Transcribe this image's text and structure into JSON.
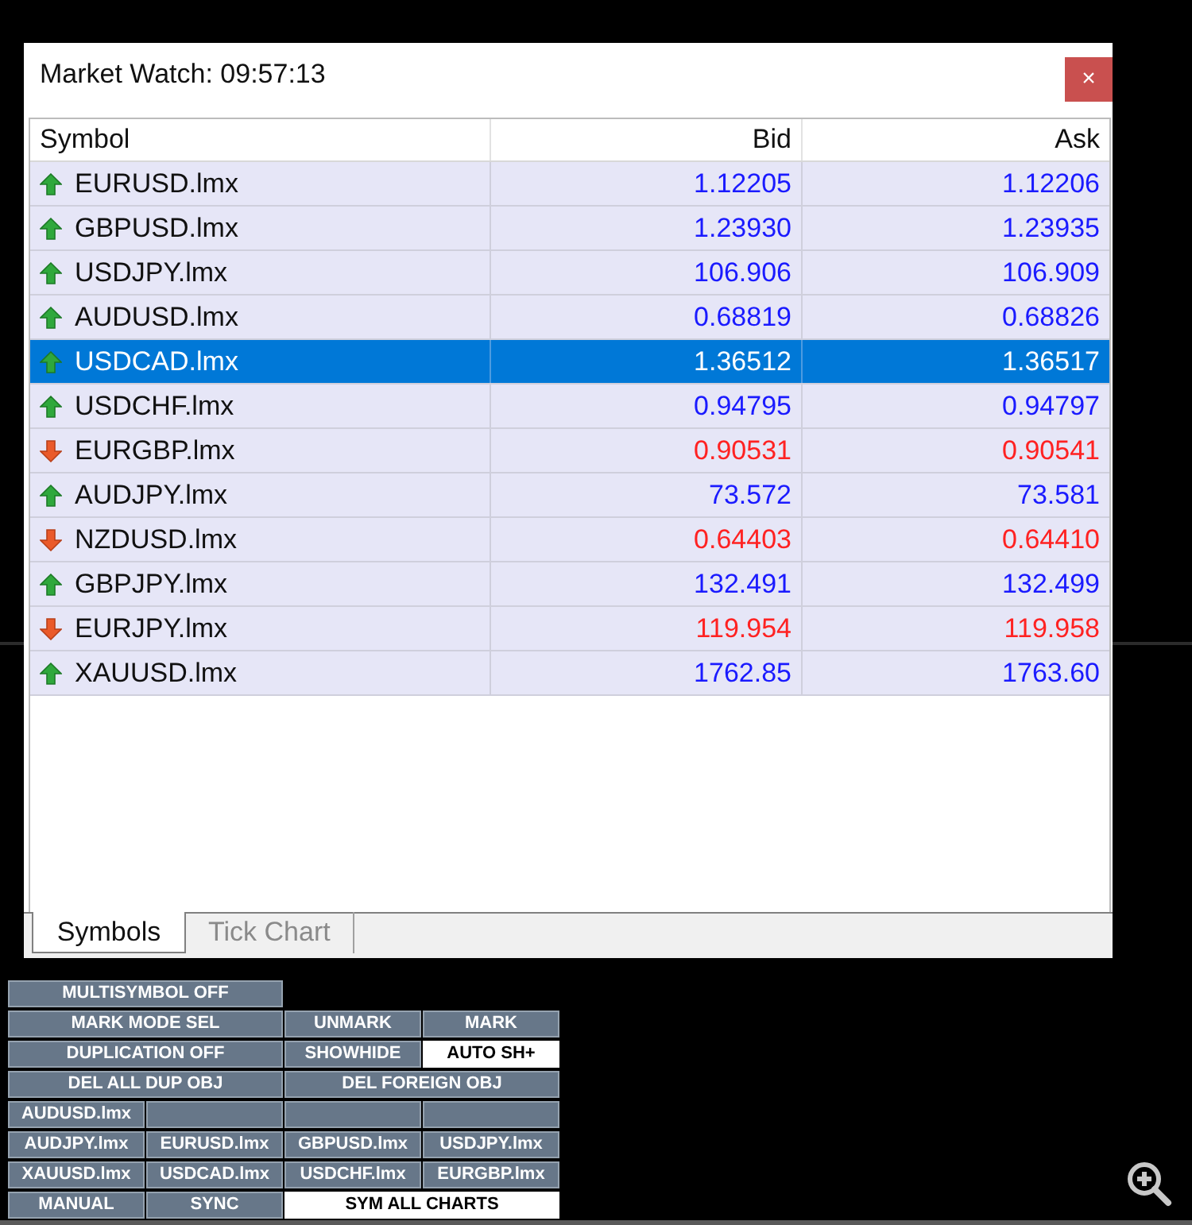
{
  "window": {
    "title": "Market Watch: 09:57:13",
    "close": "×"
  },
  "table": {
    "columns": [
      "Symbol",
      "Bid",
      "Ask"
    ],
    "rows": [
      {
        "symbol": "EURUSD.lmx",
        "bid": "1.12205",
        "ask": "1.12206",
        "kind": "up",
        "selected": false
      },
      {
        "symbol": "GBPUSD.lmx",
        "bid": "1.23930",
        "ask": "1.23935",
        "kind": "up",
        "selected": false
      },
      {
        "symbol": "USDJPY.lmx",
        "bid": "106.906",
        "ask": "106.909",
        "kind": "up",
        "selected": false
      },
      {
        "symbol": "AUDUSD.lmx",
        "bid": "0.68819",
        "ask": "0.68826",
        "kind": "up",
        "selected": false
      },
      {
        "symbol": "USDCAD.lmx",
        "bid": "1.36512",
        "ask": "1.36517",
        "kind": "up",
        "selected": true
      },
      {
        "symbol": "USDCHF.lmx",
        "bid": "0.94795",
        "ask": "0.94797",
        "kind": "up",
        "selected": false
      },
      {
        "symbol": "EURGBP.lmx",
        "bid": "0.90531",
        "ask": "0.90541",
        "kind": "down",
        "selected": false
      },
      {
        "symbol": "AUDJPY.lmx",
        "bid": "73.572",
        "ask": "73.581",
        "kind": "up",
        "selected": false
      },
      {
        "symbol": "NZDUSD.lmx",
        "bid": "0.64403",
        "ask": "0.64410",
        "kind": "down",
        "selected": false
      },
      {
        "symbol": "GBPJPY.lmx",
        "bid": "132.491",
        "ask": "132.499",
        "kind": "up",
        "selected": false
      },
      {
        "symbol": "EURJPY.lmx",
        "bid": "119.954",
        "ask": "119.958",
        "kind": "down",
        "selected": false
      },
      {
        "symbol": "XAUUSD.lmx",
        "bid": "1762.85",
        "ask": "1763.60",
        "kind": "up",
        "selected": false
      }
    ]
  },
  "tabs": [
    {
      "label": "Symbols",
      "selected": true
    },
    {
      "label": "Tick Chart",
      "selected": false
    }
  ],
  "button_panel": {
    "rows": [
      [
        {
          "label": "MULTISYMBOL OFF",
          "kind": "wide",
          "on": false
        }
      ],
      [
        {
          "label": "MARK MODE SEL",
          "kind": "wide",
          "on": false
        },
        {
          "label": "UNMARK",
          "kind": "single",
          "on": false
        },
        {
          "label": "MARK",
          "kind": "single",
          "on": false
        }
      ],
      [
        {
          "label": "DUPLICATION OFF",
          "kind": "wide",
          "on": false
        },
        {
          "label": "SHOWHIDE",
          "kind": "single",
          "on": false
        },
        {
          "label": "AUTO SH+",
          "kind": "single",
          "on": true
        }
      ],
      [
        {
          "label": "DEL ALL DUP OBJ",
          "kind": "wide",
          "on": false
        },
        {
          "label": "DEL FOREIGN OBJ",
          "kind": "wide",
          "on": false
        }
      ],
      [
        {
          "label": "AUDUSD.lmx",
          "kind": "single",
          "on": false
        },
        {
          "kind": "single",
          "on": false
        },
        {
          "kind": "single",
          "on": false
        },
        {
          "kind": "single",
          "on": false
        }
      ],
      [
        {
          "label": "AUDJPY.lmx",
          "kind": "single",
          "on": false
        },
        {
          "label": "EURUSD.lmx",
          "kind": "single",
          "on": false
        },
        {
          "label": "GBPUSD.lmx",
          "kind": "single",
          "on": false
        },
        {
          "label": "USDJPY.lmx",
          "kind": "single",
          "on": false
        }
      ],
      [
        {
          "label": "XAUUSD.lmx",
          "kind": "single",
          "on": false
        },
        {
          "label": "USDCAD.lmx",
          "kind": "single",
          "on": false
        },
        {
          "label": "USDCHF.lmx",
          "kind": "single",
          "on": false
        },
        {
          "label": "EURGBP.lmx",
          "kind": "single",
          "on": false
        }
      ],
      [
        {
          "label": "MANUAL",
          "kind": "single",
          "on": false
        },
        {
          "label": "SYNC",
          "kind": "single",
          "on": false
        },
        {
          "label": "SYM ALL CHARTS",
          "kind": "wide",
          "on": true
        }
      ]
    ]
  }
}
